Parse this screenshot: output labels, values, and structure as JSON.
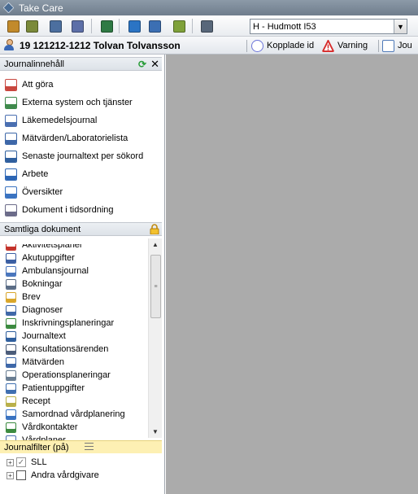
{
  "window": {
    "title": "Take Care"
  },
  "toolbar": {
    "buttons": [
      {
        "name": "journal-book-icon",
        "color": "#c28a2b"
      },
      {
        "name": "calculator-icon",
        "color": "#7b8a3a"
      },
      {
        "name": "barcode-icon",
        "color": "#4c6f9f"
      },
      {
        "name": "checklist-icon",
        "color": "#5d6fa8"
      },
      {
        "name": "monitor-icon",
        "color": "#2f7a44"
      },
      {
        "name": "globe-icon",
        "color": "#2b74c4"
      },
      {
        "name": "network-icon",
        "color": "#3c6fb3"
      },
      {
        "name": "card-icon",
        "color": "#7fa13a"
      },
      {
        "name": "computer-icon",
        "color": "#58677a"
      }
    ],
    "unit_select": {
      "value": "H - Hudmott I53"
    }
  },
  "patient": {
    "text": "19  121212-1212 Tolvan Tolvansson",
    "buttons": [
      {
        "label": "Kopplade id",
        "icon": "linked-id-icon",
        "color": "#6b74d9"
      },
      {
        "label": "Varning",
        "icon": "warning-icon",
        "color": "#d62a2a"
      },
      {
        "label": "Jou",
        "icon": "journal-tab-icon",
        "color": "#4e79b8"
      }
    ]
  },
  "journal_panel": {
    "title": "Journalinnehåll",
    "items": [
      {
        "label": "Att göra",
        "icon": "todo-icon",
        "color": "#c8473f"
      },
      {
        "label": "Externa system och tjänster",
        "icon": "external-systems-icon",
        "color": "#3f8a4c"
      },
      {
        "label": "Läkemedelsjournal",
        "icon": "medication-icon",
        "color": "#4a6fb1"
      },
      {
        "label": "Mätvärden/Laboratorielista",
        "icon": "lab-icon",
        "color": "#3d67a8"
      },
      {
        "label": "Senaste journaltext per sökord",
        "icon": "text-icon",
        "color": "#2f5f9e"
      },
      {
        "label": "Arbete",
        "icon": "work-icon",
        "color": "#2d66b5"
      },
      {
        "label": "Översikter",
        "icon": "overview-icon",
        "color": "#3a73c1"
      },
      {
        "label": "Dokument i tidsordning",
        "icon": "timeline-icon",
        "color": "#6c6c8a"
      }
    ]
  },
  "documents_panel": {
    "title": "Samtliga dokument",
    "lock_icon": "lock-icon",
    "items": [
      {
        "label": "Aktivitetsplaner",
        "color": "#c4332b"
      },
      {
        "label": "Akutuppgifter",
        "color": "#3c5fa3"
      },
      {
        "label": "Ambulansjournal",
        "color": "#4a76bd"
      },
      {
        "label": "Bokningar",
        "color": "#5b6d86"
      },
      {
        "label": "Brev",
        "color": "#d9a62a"
      },
      {
        "label": "Diagnoser",
        "color": "#4068a8"
      },
      {
        "label": "Inskrivningsplaneringar",
        "color": "#3b8a3f"
      },
      {
        "label": "Journaltext",
        "color": "#2f5f9e"
      },
      {
        "label": "Konsultationsärenden",
        "color": "#4b5c7a"
      },
      {
        "label": "Mätvärden",
        "color": "#3d67a8"
      },
      {
        "label": "Operationsplaneringar",
        "color": "#6a7e93"
      },
      {
        "label": "Patientuppgifter",
        "color": "#3f6fb0"
      },
      {
        "label": "Recept",
        "color": "#b9b04a"
      },
      {
        "label": "Samordnad vårdplanering",
        "color": "#3a73c1"
      },
      {
        "label": "Vårdkontakter",
        "color": "#3b8a3f"
      },
      {
        "label": "Vårdplaner",
        "color": "#4a6fb1"
      }
    ]
  },
  "filter_panel": {
    "title": "Journalfilter (på)",
    "items": [
      {
        "label": "SLL",
        "checked": true
      },
      {
        "label": "Andra vårdgivare",
        "checked": false
      }
    ]
  },
  "glyphs": {
    "expander": "+",
    "check": "✓",
    "arrow_down": "▼",
    "arrow_up": "▲",
    "close": "✕",
    "refresh": "⟳",
    "grip": "≡"
  }
}
